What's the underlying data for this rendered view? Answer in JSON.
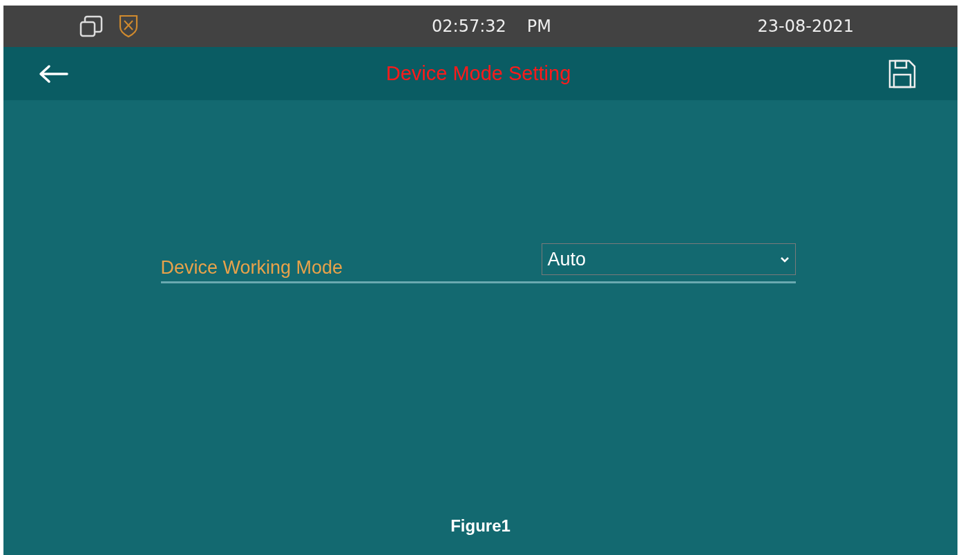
{
  "status_bar": {
    "time": "02:57:32",
    "meridiem": "PM",
    "date": "23-08-2021"
  },
  "header": {
    "title": "Device Mode Setting"
  },
  "setting": {
    "label": "Device Working Mode",
    "value": "Auto"
  },
  "caption": "Figure1"
}
